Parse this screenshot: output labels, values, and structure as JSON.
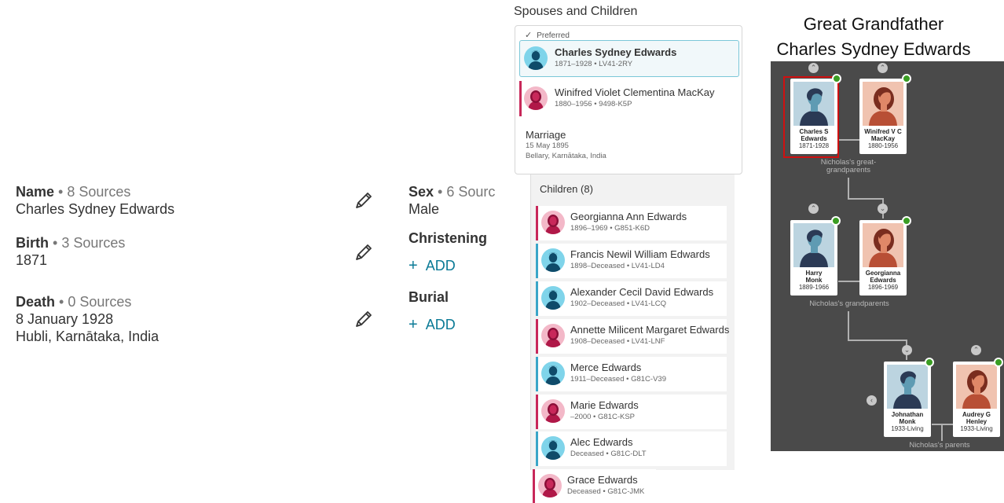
{
  "vitals": {
    "name": {
      "label": "Name",
      "sources": "• 8 Sources",
      "value": "Charles Sydney Edwards"
    },
    "birth": {
      "label": "Birth",
      "sources": "• 3 Sources",
      "value": "1871"
    },
    "death": {
      "label": "Death",
      "sources": "• 0 Sources",
      "value1": "8 January 1928",
      "value2": "Hubli, Karnātaka, India"
    },
    "sex": {
      "label": "Sex",
      "sources": "• 6 Sourc",
      "value": "Male"
    },
    "christening": {
      "label": "Christening",
      "add": "ADD"
    },
    "burial": {
      "label": "Burial",
      "add": "ADD"
    }
  },
  "spouses": {
    "title": "Spouses and Children",
    "preferred": "Preferred",
    "husband": {
      "name": "Charles Sydney Edwards",
      "meta": "1871–1928 • LV41-2RY"
    },
    "wife": {
      "name": "Winifred Violet Clementina MacKay",
      "meta": "1880–1956 • 9498-K5P"
    },
    "marriage": {
      "label": "Marriage",
      "date": "15 May 1895",
      "place": "Bellary, Karnātaka, India"
    }
  },
  "children_header": "Children (8)",
  "children": [
    {
      "name": "Georgianna Ann Edwards",
      "meta": "1896–1969 • G851-K6D",
      "sex": "f"
    },
    {
      "name": "Francis Newil William Edwards",
      "meta": "1898–Deceased • LV41-LD4",
      "sex": "m"
    },
    {
      "name": "Alexander Cecil David Edwards",
      "meta": "1902–Deceased • LV41-LCQ",
      "sex": "m"
    },
    {
      "name": "Annette Milicent Margaret Edwards",
      "meta": "1908–Deceased • LV41-LNF",
      "sex": "f"
    },
    {
      "name": "Merce Edwards",
      "meta": "1911–Deceased • G81C-V39",
      "sex": "m"
    },
    {
      "name": "Marie Edwards",
      "meta": "–2000 • G81C-KSP",
      "sex": "f"
    },
    {
      "name": "Alec Edwards",
      "meta": "Deceased • G81C-DLT",
      "sex": "m"
    },
    {
      "name": "Grace Edwards",
      "meta": "Deceased • G81C-JMK",
      "sex": "f"
    }
  ],
  "tree": {
    "title1": "Great Grandfather",
    "title2": "Charles Sydney Edwards",
    "people": [
      {
        "name": "Charles S\nEdwards",
        "dates": "1871-1928",
        "sex": "m"
      },
      {
        "name": "Winifred V C\nMacKay",
        "dates": "1880-1956",
        "sex": "f"
      },
      {
        "name": "Harry\nMonk",
        "dates": "1889-1966",
        "sex": "m"
      },
      {
        "name": "Georgianna\nEdwards",
        "dates": "1896-1969",
        "sex": "f"
      },
      {
        "name": "Johnathan\nMonk",
        "dates": "1933-Living",
        "sex": "m"
      },
      {
        "name": "Audrey G\nHenley",
        "dates": "1933-Living",
        "sex": "f"
      }
    ],
    "captions": [
      "Nicholas's great-\ngrandparents",
      "Nicholas's grandparents",
      "Nicholas's parents"
    ]
  },
  "colors": {
    "accent": "#0a7a96",
    "male_stripe": "#3aa6c8",
    "female_stripe": "#c8285a",
    "selected_border": "#d01010",
    "tree_bg": "#4a4a4a"
  }
}
